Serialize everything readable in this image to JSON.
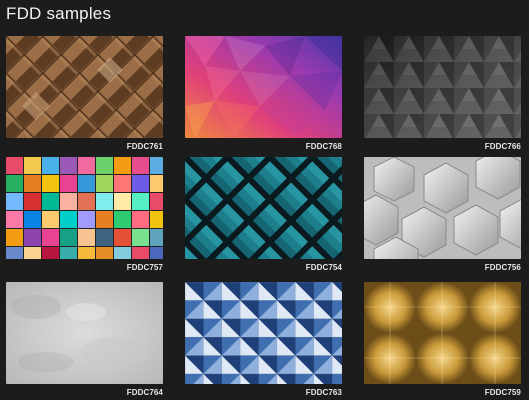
{
  "page": {
    "title": "FDD samples"
  },
  "samples": [
    {
      "code": "FDDC761",
      "icon": "wood-blocks-texture"
    },
    {
      "code": "FDDC768",
      "icon": "pink-purple-low-poly-texture"
    },
    {
      "code": "FDDC766",
      "icon": "dark-triangles-texture"
    },
    {
      "code": "FDDC757",
      "icon": "colorful-cubes-texture"
    },
    {
      "code": "FDDC754",
      "icon": "teal-quilted-diamonds-texture"
    },
    {
      "code": "FDDC756",
      "icon": "silver-hexagons-texture"
    },
    {
      "code": "FDDC764",
      "icon": "grey-concrete-texture"
    },
    {
      "code": "FDDC763",
      "icon": "blue-pyramids-texture"
    },
    {
      "code": "FDDC759",
      "icon": "brushed-gold-texture"
    }
  ]
}
